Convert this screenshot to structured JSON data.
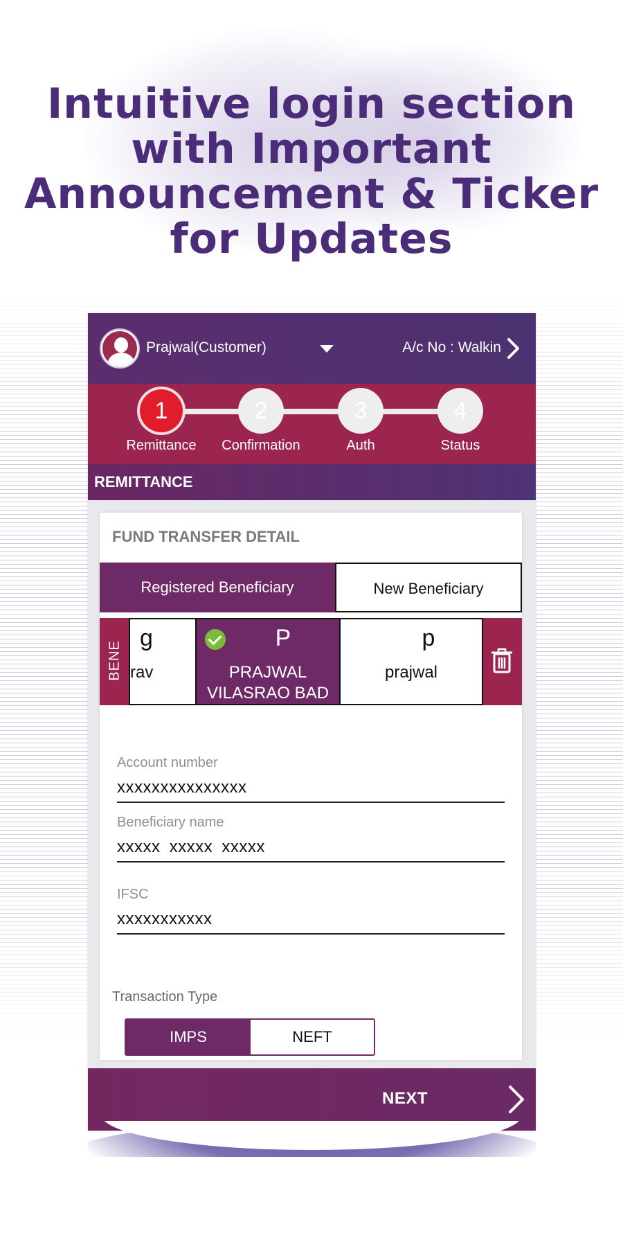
{
  "headline": {
    "line1": "Intuitive login section",
    "line2": "with Important",
    "line3": "Announcement & Ticker",
    "line4": "for Updates"
  },
  "header": {
    "username": "Prajwal(Customer)",
    "account": "A/c No : Walkin"
  },
  "steps": [
    {
      "num": "1",
      "label": "Remittance"
    },
    {
      "num": "2",
      "label": "Confirmation"
    },
    {
      "num": "3",
      "label": "Auth"
    },
    {
      "num": "4",
      "label": "Status"
    }
  ],
  "section_title": "REMITTANCE",
  "card": {
    "title": "FUND TRANSFER DETAIL",
    "tab_registered": "Registered Beneficiary",
    "tab_new": "New Beneficiary",
    "bene_label": "BENE",
    "beneficiaries": [
      {
        "initial": "g",
        "name": "rav"
      },
      {
        "initial": "P",
        "name_line1": "PRAJWAL",
        "name_line2": "VILASRAO BAD"
      },
      {
        "initial": "p",
        "name": "prajwal"
      }
    ],
    "fields": {
      "account_label": "Account number",
      "account_value": "xxxxxxxxxxxxxxx",
      "bene_name_label": "Beneficiary name",
      "bene_name_value": "xxxxx xxxxx xxxxx",
      "ifsc_label": "IFSC",
      "ifsc_value": "xxxxxxxxxxx"
    },
    "transaction_type_label": "Transaction Type",
    "transaction_options": [
      "IMPS",
      "NEFT"
    ]
  },
  "next_label": "NEXT",
  "colors": {
    "brand_purple": "#6e2a66",
    "step_bar": "#9c2550",
    "active_step": "#e21d2b",
    "headline": "#4a2c78"
  },
  "icons": [
    "user-avatar-icon",
    "chevron-down-icon",
    "chevron-right-icon",
    "check-icon",
    "trash-icon"
  ]
}
